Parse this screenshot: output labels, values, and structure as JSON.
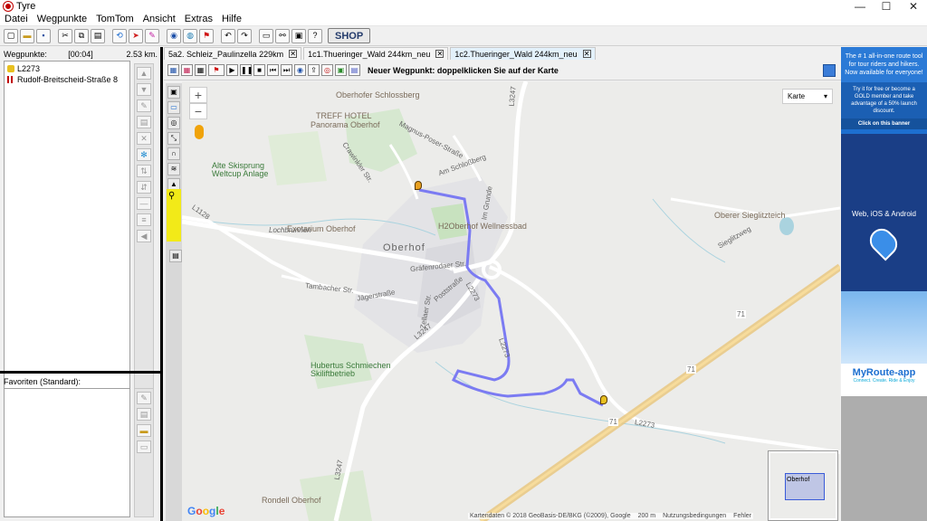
{
  "window": {
    "title": "Tyre",
    "minimize": "—",
    "maximize": "☐",
    "close": "✕"
  },
  "menu": [
    "Datei",
    "Wegpunkte",
    "TomTom",
    "Ansicht",
    "Extras",
    "Hilfe"
  ],
  "toolbar": {
    "shop_label": "SHOP"
  },
  "waypoints": {
    "label": "Wegpunkte:",
    "time": "[00:04]",
    "distance": "2.53 km.",
    "items": [
      "L2273",
      "Rudolf-Breitscheid-Straße 8"
    ]
  },
  "favorites": {
    "label": "Favoriten (Standard):"
  },
  "tabs": [
    {
      "label": "5a2. Schleiz_Paulinzella 229km",
      "active": false
    },
    {
      "label": "1c1.Thueringer_Wald 244km_neu",
      "active": false
    },
    {
      "label": "1c2.Thueringer_Wald 244km_neu",
      "active": true
    }
  ],
  "map": {
    "status_message": "Neuer Wegpunkt: doppelklicken Sie auf der Karte",
    "zoom_in": "+",
    "zoom_out": "−",
    "map_type": "Karte",
    "labels": {
      "schlossberg": "Oberhofer Schlossberg",
      "treff_hotel": "TREFF HOTEL",
      "panorama": "Panorama Oberhof",
      "magnus": "Magnus-Poser-Straße",
      "schlossberg_street": "Am Schloßberg",
      "grunde": "Im Grunde",
      "crawinkler": "Crawinkler Str.",
      "skisprung": "Alte Skisprung",
      "weltcup": "Weltcup Anlage",
      "exotarium": "Exotarium Oberhof",
      "h2oberhof": "H2Oberhof Wellnessbad",
      "oberhof": "Oberhof",
      "lochbrunnen": "Lochbrunnen",
      "grafenrodaer": "Gräfenrodaer Str.",
      "tambacher": "Tambacher Str.",
      "jaegerstrasse": "Jägerstraße",
      "poststrasse": "Poststraße",
      "zellaer": "Zellaer Str.",
      "l1128": "L1128",
      "l3247_top": "L3247",
      "l3247_mid": "L3247",
      "l3247_bottom": "L3247",
      "l2273_a": "L2273",
      "l2273_b": "L2273",
      "l2273_c": "L2273",
      "hubertus": "Hubertus Schmiechen",
      "skilift": "Skiliftbetrieb",
      "sieglitzteich": "Oberer Sieglitzteich",
      "sieglitz_road": "Sieglitzweg",
      "a71_a": "71",
      "a71_b": "71",
      "a71_c": "71",
      "a71_d": "71",
      "rondell": "Rondell Oberhof",
      "minimap": "Oberhof"
    },
    "attribution": "Kartendaten © 2018 GeoBasis-DE/BKG (©2009), Google",
    "scale": "200 m",
    "terms": "Nutzungsbedingungen",
    "error": "Fehler",
    "google": [
      "G",
      "o",
      "o",
      "g",
      "l",
      "e"
    ]
  },
  "ad": {
    "headline": "The # 1 all-in-one route tool for tour riders and hikers. Now available for everyone!",
    "offer": "Try it for free or become a GOLD member and take advantage of a 50% launch discount.",
    "click": "Click on this banner",
    "platforms": "Web, iOS & Android",
    "brand": "MyRoute-app",
    "tagline": "Connect. Create. Ride & Enjoy"
  },
  "colors": {
    "route": "#7b7bf2",
    "yellow_tool": "#f2ea18",
    "ad_blue": "#1d6fd0"
  }
}
